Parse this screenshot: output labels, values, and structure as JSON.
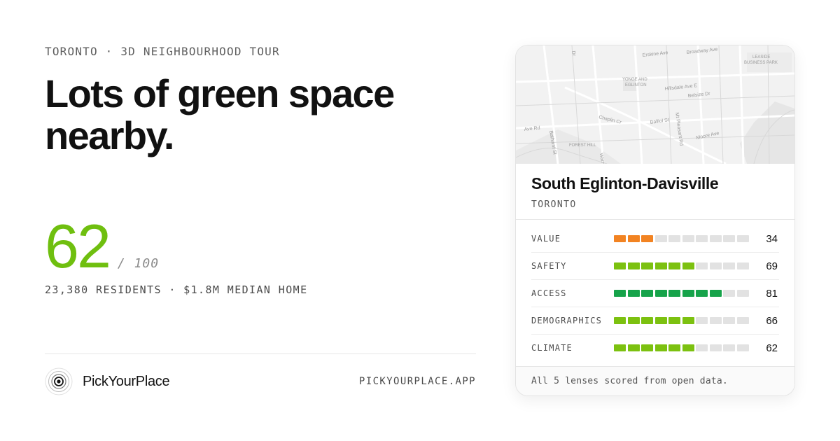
{
  "eyebrow": "TORONTO · 3D NEIGHBOURHOOD TOUR",
  "headline": "Lots of green space nearby.",
  "score": {
    "value": "62",
    "out_of": "/ 100",
    "value_num": 62,
    "color": "#6fbf0f"
  },
  "stats": "23,380 RESIDENTS · $1.8M MEDIAN HOME",
  "brand": {
    "name": "PickYourPlace",
    "url": "PICKYOURPLACE.APP"
  },
  "card": {
    "map_labels": {
      "erskine": "Erskine Ave",
      "broadway": "Broadway Ave",
      "leaside_1": "LEASIDE",
      "leaside_2": "BUSINESS PARK",
      "yonge_1": "YONGE AND",
      "yonge_2": "EGLINTON",
      "hillsdale": "Hillsdale Ave E",
      "belsize": "Belsize Dr",
      "chaplin": "Chaplin Cr",
      "balliol": "Balliol St",
      "mtpleasant": "Mt Pleasant Rd",
      "moore": "Moore Ave",
      "ave_rd": "Ave Rd",
      "bathurst": "Bathurst St",
      "forest_hill": "FOREST HILL",
      "warren": "Warren",
      "top_dr": "Dr",
      "top_ave": "ee Ave"
    },
    "name": "South Eglinton-Davisville",
    "city": "TORONTO",
    "lenses": [
      {
        "label": "VALUE",
        "value": "34",
        "score": 34,
        "color": "#f28322"
      },
      {
        "label": "SAFETY",
        "value": "69",
        "score": 69,
        "color": "#7cc110"
      },
      {
        "label": "ACCESS",
        "value": "81",
        "score": 81,
        "color": "#16a34a"
      },
      {
        "label": "DEMOGRAPHICS",
        "value": "66",
        "score": 66,
        "color": "#7cc110"
      },
      {
        "label": "CLIMATE",
        "value": "62",
        "score": 62,
        "color": "#7cc110"
      }
    ],
    "footer": "All 5 lenses scored from open data."
  }
}
